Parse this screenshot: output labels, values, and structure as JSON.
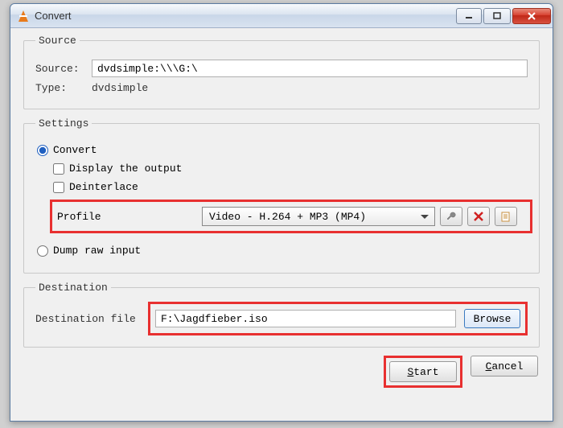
{
  "titlebar": {
    "title": "Convert"
  },
  "source_group": {
    "legend": "Source",
    "source_label": "Source:",
    "source_value": "dvdsimple:\\\\\\G:\\",
    "type_label": "Type:",
    "type_value": "dvdsimple"
  },
  "settings_group": {
    "legend": "Settings",
    "convert_label": "Convert",
    "display_output_label": "Display the output",
    "deinterlace_label": "Deinterlace",
    "profile_label": "Profile",
    "profile_value": "Video - H.264 + MP3 (MP4)",
    "dump_label": "Dump raw input"
  },
  "destination_group": {
    "legend": "Destination",
    "file_label": "Destination file",
    "file_value": "F:\\Jagdfieber.iso",
    "browse_label": "Browse"
  },
  "buttons": {
    "start_prefix": "S",
    "start_rest": "tart",
    "cancel_prefix": "C",
    "cancel_rest": "ancel"
  }
}
